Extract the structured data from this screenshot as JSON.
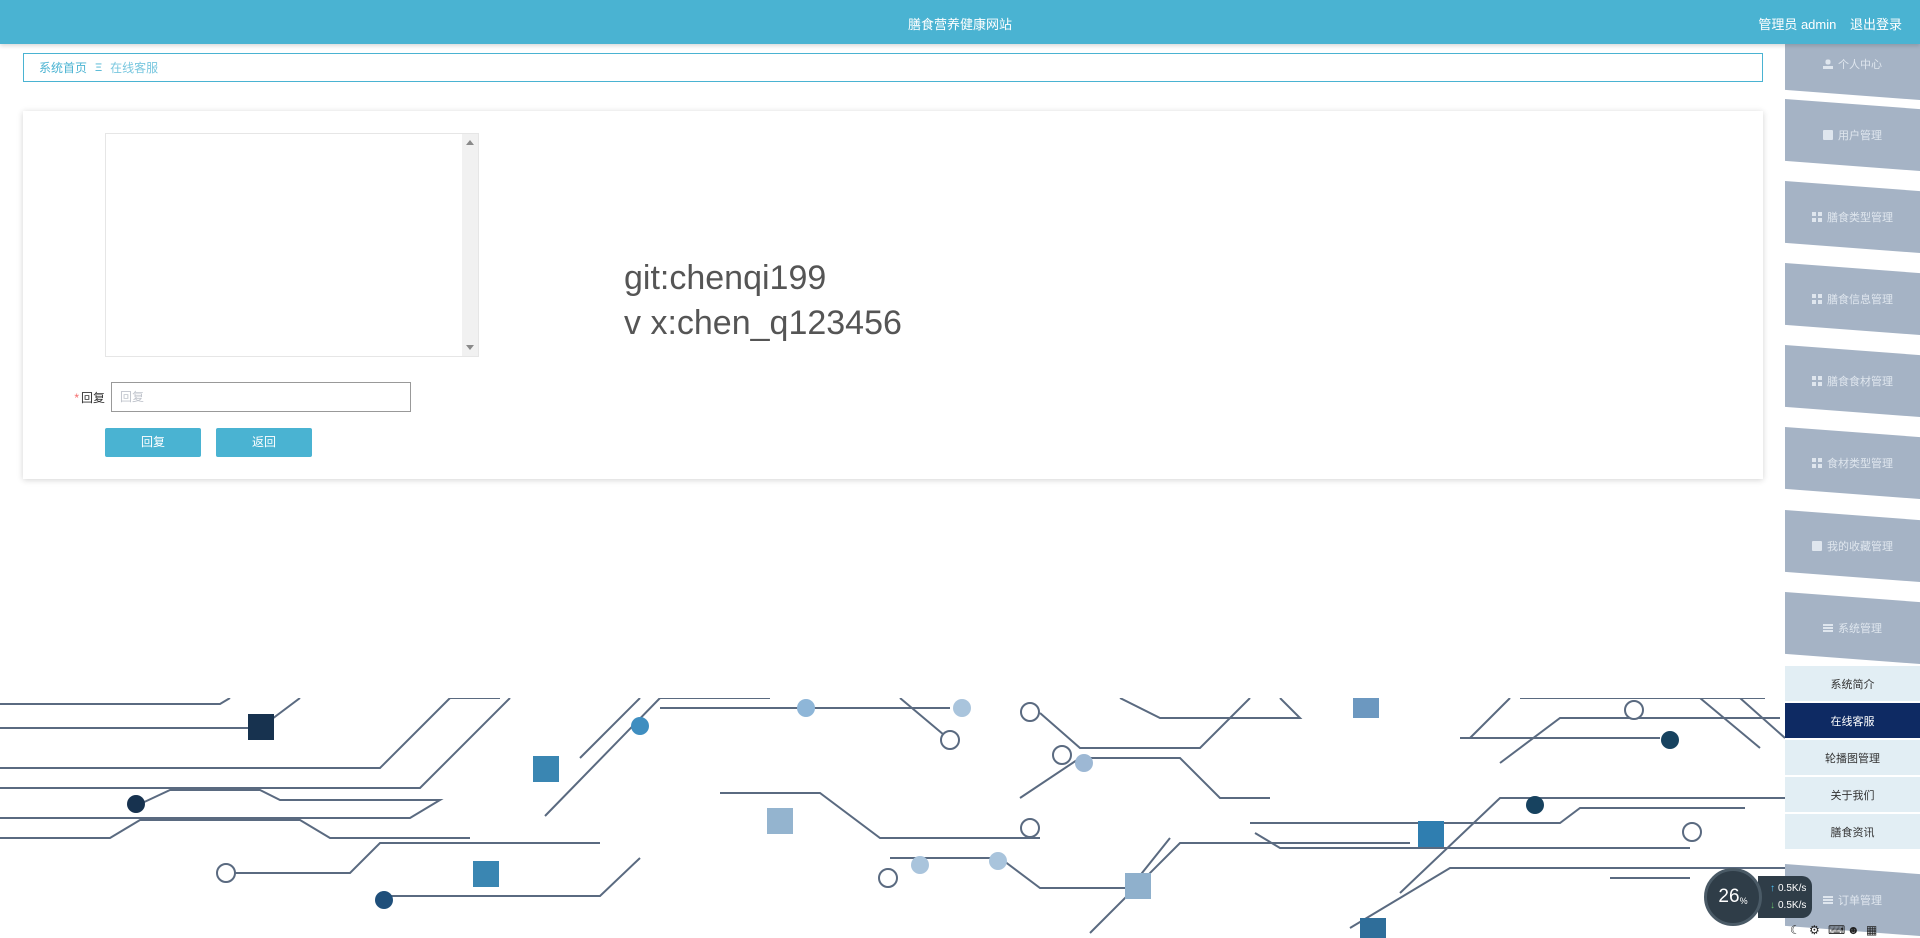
{
  "header": {
    "site_title": "膳食营养健康网站",
    "user_label": "管理员 admin",
    "logout_label": "退出登录"
  },
  "breadcrumb": {
    "home": "系统首页",
    "separator": "Ξ",
    "current": "在线客服"
  },
  "chat": {
    "watermark_line1": "git:chenqi199",
    "watermark_line2": "v x:chen_q123456"
  },
  "form": {
    "required_mark": "*",
    "reply_label": "回复",
    "reply_placeholder": "回复",
    "reply_value": "",
    "reply_button": "回复",
    "back_button": "返回"
  },
  "sidebar": {
    "items": [
      {
        "label": "个人中心",
        "icon": "user-icon"
      },
      {
        "label": "用户管理",
        "icon": "briefcase-icon"
      },
      {
        "label": "膳食类型管理",
        "icon": "grid-icon"
      },
      {
        "label": "膳食信息管理",
        "icon": "grid-icon"
      },
      {
        "label": "膳食食材管理",
        "icon": "grid-icon"
      },
      {
        "label": "食材类型管理",
        "icon": "grid-icon"
      },
      {
        "label": "我的收藏管理",
        "icon": "briefcase-icon"
      },
      {
        "label": "系统管理",
        "icon": "list-icon"
      }
    ],
    "sub_items": [
      {
        "label": "系统简介",
        "active": false
      },
      {
        "label": "在线客服",
        "active": true
      },
      {
        "label": "轮播图管理",
        "active": false
      },
      {
        "label": "关于我们",
        "active": false
      },
      {
        "label": "膳食资讯",
        "active": false
      }
    ],
    "bottom_item": {
      "label": "订单管理",
      "icon": "list-icon"
    }
  },
  "netmon": {
    "percent": "26",
    "percent_unit": "%",
    "upload": "0.5",
    "download": "0.5",
    "speed_unit": "K/s"
  },
  "colors": {
    "primary": "#4ab3d2",
    "sidebar_item": "#a5b3c5",
    "active_nav": "#0e2a63",
    "sub_nav_bg": "#e2eef4"
  }
}
